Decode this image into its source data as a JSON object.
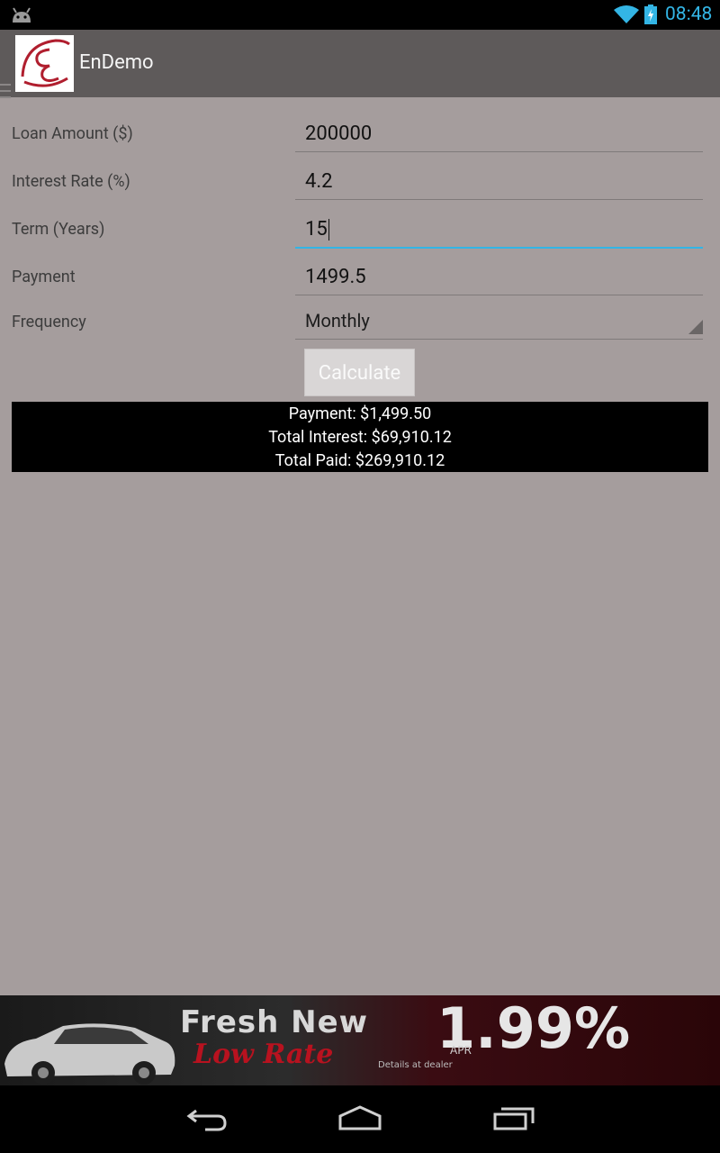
{
  "status_bar": {
    "time": "08:48"
  },
  "action_bar": {
    "title": "EnDemo"
  },
  "form": {
    "loan_amount": {
      "label": "Loan Amount ($)",
      "value": "200000"
    },
    "interest_rate": {
      "label": "Interest Rate (%)",
      "value": "4.2"
    },
    "term": {
      "label": "Term (Years)",
      "value": "15"
    },
    "payment": {
      "label": "Payment",
      "value": "1499.5"
    },
    "frequency": {
      "label": "Frequency",
      "value": "Monthly"
    }
  },
  "calculate_button": {
    "label": "Calculate"
  },
  "results": {
    "payment": "Payment: $1,499.50",
    "total_interest": "Total Interest: $69,910.12",
    "total_paid": "Total Paid: $269,910.12"
  },
  "ad_banner": {
    "headline": "Fresh New",
    "subline": "Low Rate",
    "rate": "1.99%",
    "fine_print": "Details at dealer",
    "rate_note": "APR"
  },
  "icons": {
    "status": [
      "android-icon",
      "wifi-icon",
      "battery-charging-icon"
    ],
    "nav": [
      "back-icon",
      "home-icon",
      "recent-apps-icon"
    ]
  },
  "colors": {
    "accent": "#33b5e5",
    "background": "#a59d9d",
    "action_bar": "#5e5a5a",
    "results_background": "#000000"
  }
}
